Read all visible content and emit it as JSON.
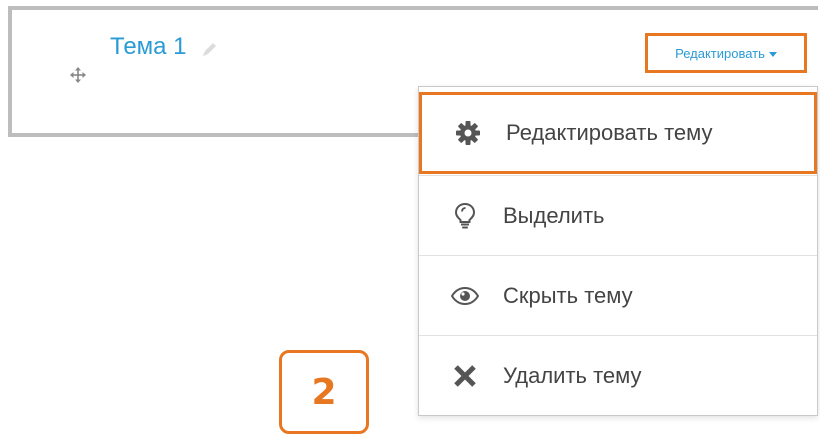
{
  "section": {
    "title": "Тема 1",
    "edit_toggle_label": "Редактировать"
  },
  "menu": {
    "items": [
      {
        "label": "Редактировать тему",
        "icon": "gear-icon",
        "highlighted": true
      },
      {
        "label": "Выделить",
        "icon": "lightbulb-icon",
        "highlighted": false
      },
      {
        "label": "Скрыть тему",
        "icon": "eye-icon",
        "highlighted": false
      },
      {
        "label": "Удалить тему",
        "icon": "close-icon",
        "highlighted": false
      }
    ]
  },
  "step_badge": "2",
  "colors": {
    "link_blue": "#2a9bd5",
    "highlight_orange": "#e87722",
    "section_border": "#bdbdbd",
    "menu_text": "#444444",
    "icon_gray": "#555555"
  }
}
